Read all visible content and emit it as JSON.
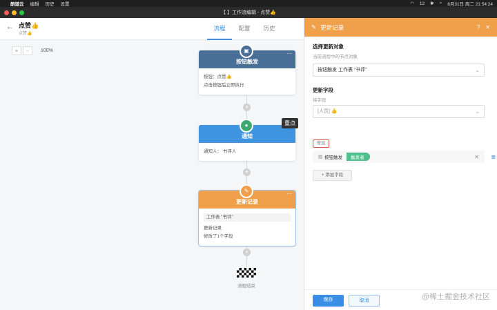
{
  "menubar": {
    "items": [
      "朗道云",
      "编辑",
      "历史",
      "设置"
    ],
    "battery": "12",
    "clock": "8月31日 周二 21:54:24"
  },
  "window": {
    "title": "【 】工作流编辑 - 点赞👍"
  },
  "header": {
    "title": "点赞👍",
    "subtitle": "点赞👍",
    "tabs": [
      {
        "label": "流程",
        "active": true
      },
      {
        "label": "配置",
        "active": false
      },
      {
        "label": "历史",
        "active": false
      }
    ]
  },
  "canvas": {
    "zoom_minus": "-",
    "zoom_plus": "+",
    "zoom_value": "100%",
    "nodes": [
      {
        "title": "按钮触发",
        "color": "#4a6f96",
        "lines": [
          "按钮：点赞👍",
          "点击按钮后立即执行"
        ]
      },
      {
        "title": "通知",
        "color": "#3f94e0",
        "lines": [
          "通知人： 书评人"
        ]
      },
      {
        "title": "更新记录",
        "color": "#f0a04b",
        "tag": "工作表 “书评”",
        "lines": [
          "更新记录",
          "修改了1个字段"
        ]
      }
    ],
    "end_label": "流程结束",
    "highlight_label": "重点"
  },
  "panel": {
    "title": "更新记录",
    "section1_title": "选择更新对象",
    "section1_hint": "当前流程中的节点对象",
    "object_select": "按钮触发  工作表 “书评”",
    "section2_title": "更新字段",
    "field_hint": "将字段",
    "field_select": "[人员] 👍",
    "add_toggle": "增加",
    "chip_label": "按钮触发",
    "chip_tag": "触发者",
    "add_field_label": "+ 添加字段",
    "save_label": "保存",
    "cancel_label": "取消"
  },
  "watermark": "@稀土掘金技术社区"
}
